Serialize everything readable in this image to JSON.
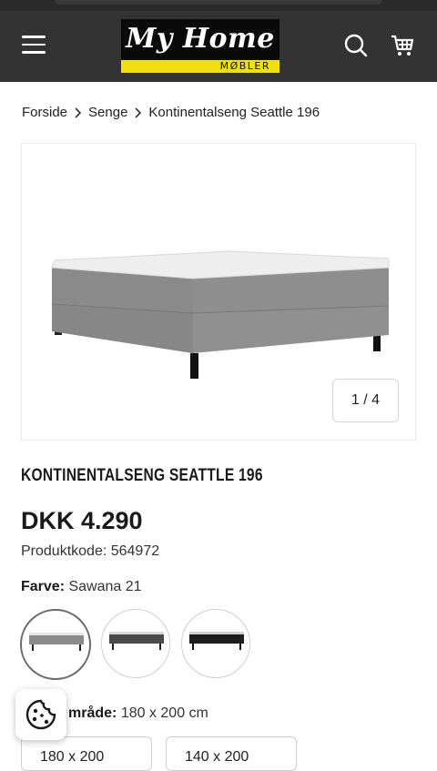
{
  "header": {
    "logo_script": "My Home",
    "logo_sub": "MØBLER",
    "icons": [
      "menu-icon",
      "search-icon",
      "cart-icon"
    ]
  },
  "breadcrumb": [
    "Forside",
    "Senge",
    "Kontinentalseng Seattle 196"
  ],
  "gallery": {
    "counter": "1 / 4",
    "current": 1,
    "total": 4
  },
  "product": {
    "title": "KONTINENTALSENG SEATTLE 196",
    "price": "DKK 4.290",
    "code": "Produktkode: 564972",
    "color_label": "Farve:",
    "color_value": "Sawana 21",
    "swatches": [
      {
        "name": "Sawana 21",
        "color": "#8a8a8a",
        "selected": true
      },
      {
        "name": "dark grey",
        "color": "#4a4a4a",
        "selected": false
      },
      {
        "name": "black",
        "color": "#1e1e1e",
        "selected": false
      }
    ],
    "size_label": "mråde:",
    "size_value": "180 x 200 cm",
    "sizes": [
      "180 x 200",
      "140 x 200"
    ]
  },
  "colors": {
    "header_bg": "#333333",
    "logo_yellow": "#f2df0f"
  }
}
